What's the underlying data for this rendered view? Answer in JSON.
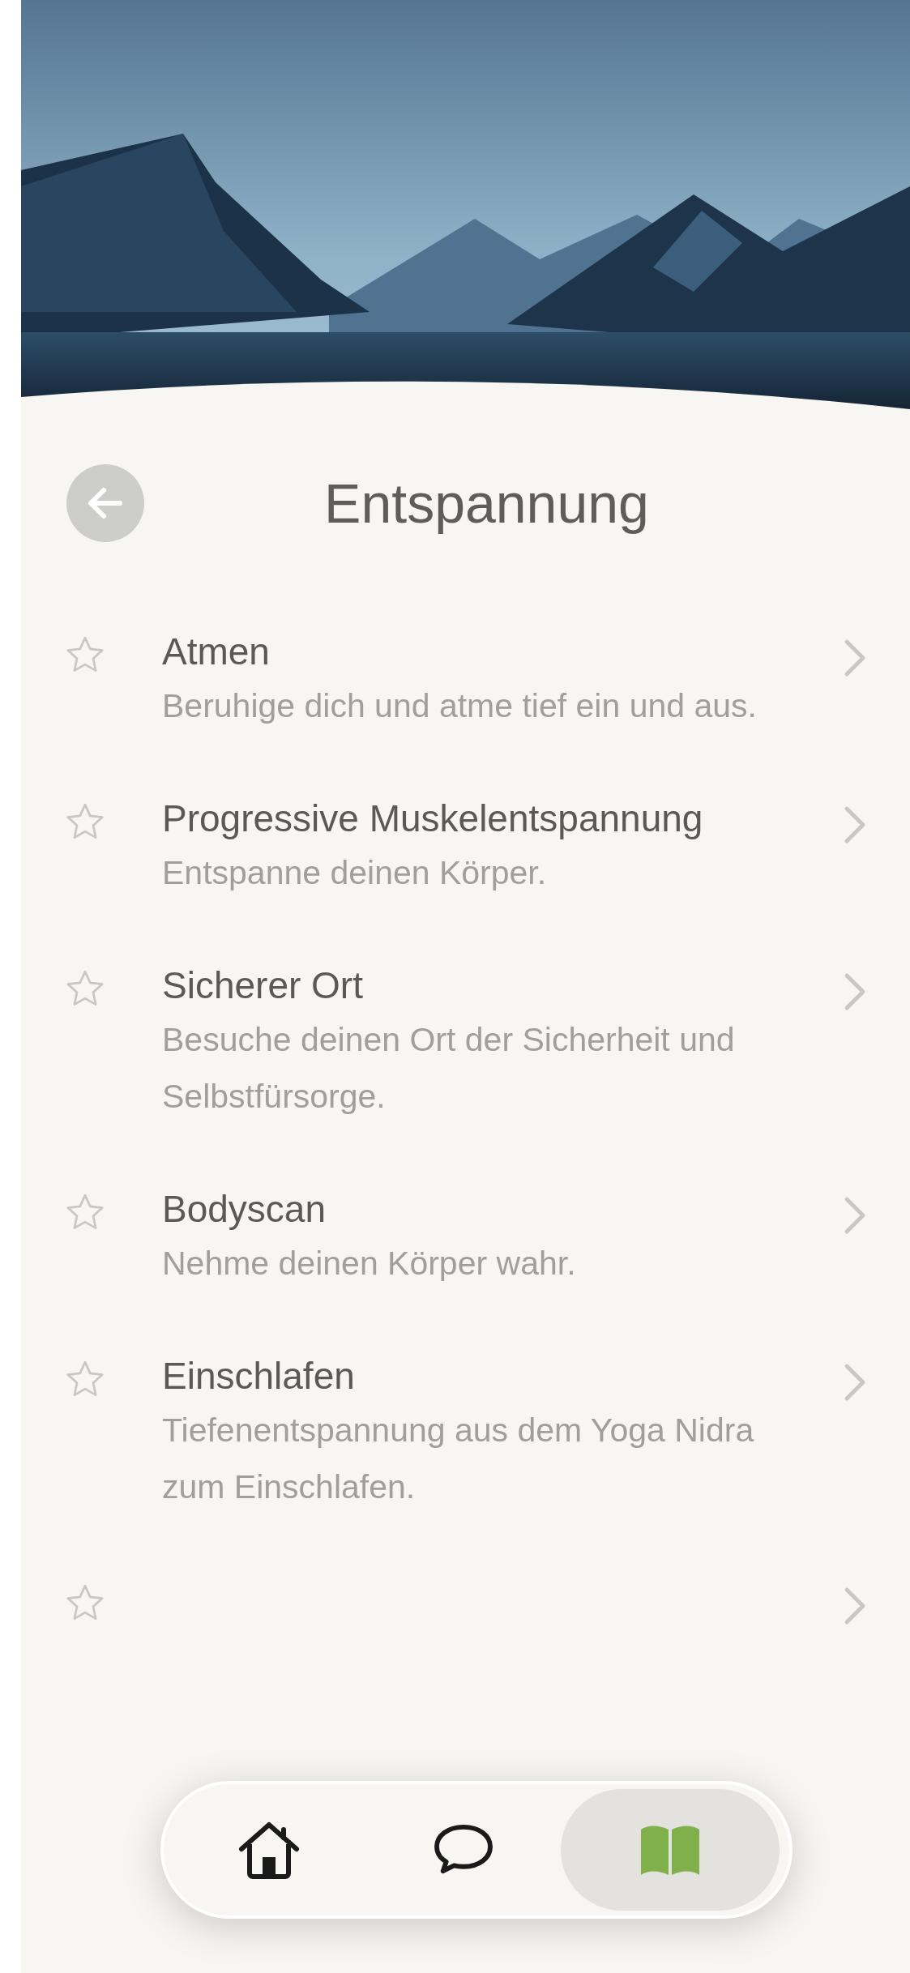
{
  "header": {
    "title": "Entspannung"
  },
  "items": [
    {
      "kind": "full",
      "title": "Atmen",
      "description": "Beruhige dich und atme tief ein und aus.",
      "favorite": false
    },
    {
      "kind": "full",
      "title": "Progressive Muskelentspannung",
      "description": "Entspanne deinen Körper.",
      "favorite": false
    },
    {
      "kind": "full",
      "title": "Sicherer Ort",
      "description": "Besuche deinen Ort der Sicherheit und Selbstfürsorge.",
      "favorite": false
    },
    {
      "kind": "full",
      "title": "Bodyscan",
      "description": "Nehme deinen Körper wahr.",
      "favorite": false
    },
    {
      "kind": "full",
      "title": "Einschlafen",
      "description": "Tiefenentspannung aus dem Yoga Nidra zum Einschlafen.",
      "favorite": false
    },
    {
      "kind": "covered",
      "favorite": false
    }
  ],
  "nav": [
    {
      "kind": "home",
      "selected": false
    },
    {
      "kind": "chat",
      "selected": false
    },
    {
      "kind": "library",
      "selected": true
    }
  ]
}
